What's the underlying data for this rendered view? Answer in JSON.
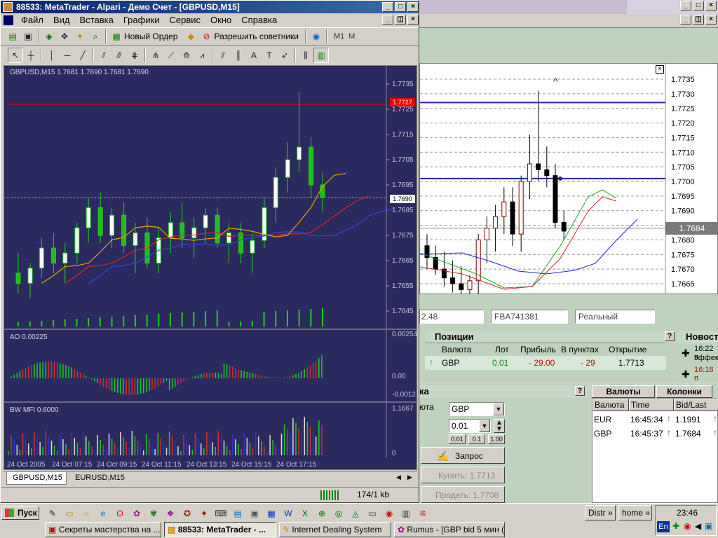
{
  "window": {
    "title": "88533: MetaTrader - Alpari - Демо Счет - [GBPUSD,M15]"
  },
  "menu": [
    "Файл",
    "Вид",
    "Вставка",
    "Графики",
    "Сервис",
    "Окно",
    "Справка"
  ],
  "toolbar": {
    "new_order": "Новый Ордер",
    "experts": "Разрешить советники",
    "tf_m1": "M1",
    "tf_m": "M"
  },
  "chart": {
    "header": "GBPUSD,M15  1.7681 1.7690 1.7681 1.7690",
    "price_ticks": [
      "1.7735",
      "1.7725",
      "1.7715",
      "1.7705",
      "1.7695",
      "1.7685",
      "1.7675",
      "1.7665",
      "1.7655",
      "1.7645"
    ],
    "red_line_label": "1.7727",
    "current_label": "1.7690",
    "ao_label": "AO 0.00225",
    "ao_ticks": [
      "0.00254",
      "0.00",
      "-0.0012"
    ],
    "mfi_label": "BW MFI 0.6000",
    "mfi_ticks": [
      "1.1667",
      "0"
    ],
    "time_labels": [
      "24 Oct 2005",
      "24 Oct 07:15",
      "24 Oct 09:15",
      "24 Oct 11:15",
      "24 Oct 13:15",
      "24 Oct 15:15",
      "24 Oct 17:15"
    ],
    "tabs": [
      "GBPUSD,M15",
      "EURUSD,M15"
    ],
    "status": "174/1 kb"
  },
  "chart_data": {
    "type": "candlestick",
    "title": "GBPUSD,M15",
    "ylim": [
      1.764,
      1.774
    ],
    "candles": [
      [
        1.766,
        1.7668,
        1.7652,
        1.7656
      ],
      [
        1.7656,
        1.7664,
        1.765,
        1.7662
      ],
      [
        1.7662,
        1.7674,
        1.7658,
        1.767
      ],
      [
        1.767,
        1.7676,
        1.766,
        1.7664
      ],
      [
        1.7664,
        1.7672,
        1.7656,
        1.7668
      ],
      [
        1.7668,
        1.768,
        1.7664,
        1.7678
      ],
      [
        1.7678,
        1.769,
        1.7672,
        1.7686
      ],
      [
        1.7686,
        1.7692,
        1.7672,
        1.7675
      ],
      [
        1.7675,
        1.7686,
        1.767,
        1.7683
      ],
      [
        1.7683,
        1.7688,
        1.7668,
        1.7671
      ],
      [
        1.7671,
        1.768,
        1.766,
        1.7676
      ],
      [
        1.7676,
        1.7682,
        1.7662,
        1.7664
      ],
      [
        1.7664,
        1.7678,
        1.766,
        1.7674
      ],
      [
        1.7674,
        1.7684,
        1.7668,
        1.768
      ],
      [
        1.768,
        1.7688,
        1.767,
        1.7674
      ],
      [
        1.7674,
        1.7682,
        1.7666,
        1.7678
      ],
      [
        1.7678,
        1.7686,
        1.7672,
        1.7683
      ],
      [
        1.7683,
        1.7686,
        1.767,
        1.7672
      ],
      [
        1.7672,
        1.768,
        1.7664,
        1.7676
      ],
      [
        1.7676,
        1.768,
        1.7664,
        1.7668
      ],
      [
        1.7668,
        1.7676,
        1.766,
        1.7673
      ],
      [
        1.7673,
        1.769,
        1.767,
        1.7686
      ],
      [
        1.7686,
        1.7702,
        1.768,
        1.7698
      ],
      [
        1.7698,
        1.7712,
        1.7692,
        1.7705
      ],
      [
        1.7705,
        1.7732,
        1.77,
        1.771
      ],
      [
        1.771,
        1.7714,
        1.769,
        1.7695
      ],
      [
        1.7695,
        1.77,
        1.7684,
        1.769
      ]
    ]
  },
  "detached_chart": {
    "price_ticks": [
      "1.7735",
      "1.7730",
      "1.7725",
      "1.7720",
      "1.7715",
      "1.7710",
      "1.7705",
      "1.7700",
      "1.7695",
      "1.7690",
      "1.7685",
      "1.7680",
      "1.7675",
      "1.7670",
      "1.7665"
    ],
    "current_label": "1.7684"
  },
  "account": {
    "field1": "2.48",
    "field2": "FBA741381",
    "field3": "Реальный"
  },
  "positions": {
    "title": "Позиции",
    "columns": [
      "Валюта",
      "Лот",
      "Прибыль",
      "В пунктах",
      "Открытие"
    ],
    "rows": [
      {
        "cur": "GBP",
        "lot": "0.01",
        "profit": "- 29.00",
        "points": "- 29",
        "open": "1.7713"
      }
    ]
  },
  "news": {
    "title": "Новости",
    "items": [
      {
        "time": "16:22 п",
        "text": "эффек"
      },
      {
        "time": "16:18 п",
        "text": ""
      }
    ]
  },
  "order": {
    "title": "ка",
    "currency_label": "юта",
    "currency": "GBP",
    "lot": "0.01",
    "lot_options": [
      "0.01",
      "0.1",
      "1.00"
    ],
    "request": "Запрос",
    "buy": "Купить: 1.7713",
    "sell": "Продать: 1.7708"
  },
  "quotes": {
    "tab_currencies": "Валюты",
    "tab_columns": "Колонки",
    "columns": [
      "Валюта",
      "Time",
      "Bid/Last"
    ],
    "rows": [
      {
        "cur": "EUR",
        "time": "16:45:34",
        "bid": "1.1991"
      },
      {
        "cur": "GBP",
        "time": "16:45:37",
        "bid": "1.7684"
      }
    ]
  },
  "taskbar": {
    "start": "Пуск",
    "tasks": [
      "Секреты мастерства на ...",
      "88533: MetaTrader - ...",
      "Internet Dealing System",
      "Rumus - [GBP bid 5 мин (..."
    ],
    "distr": "Distr",
    "home": "home",
    "clock": "23:46",
    "lang": "En"
  }
}
